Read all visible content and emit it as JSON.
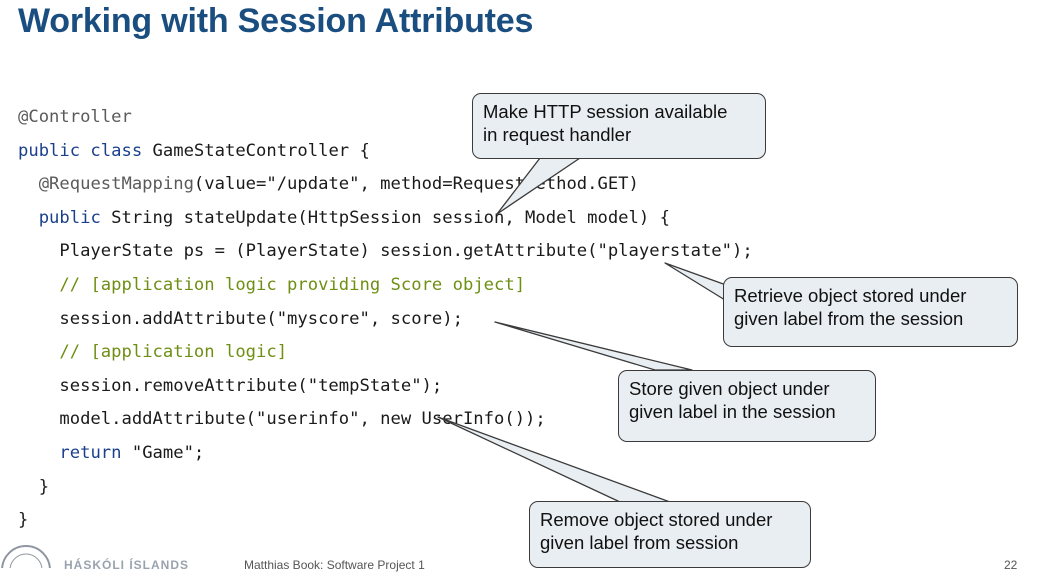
{
  "slide": {
    "title": "Working with Session Attributes"
  },
  "code": {
    "lines": [
      [
        {
          "t": "ann",
          "s": "@Controller"
        }
      ],
      [
        {
          "t": "kw",
          "s": "public class "
        },
        {
          "t": "plain",
          "s": "GameStateController {"
        }
      ],
      [
        {
          "t": "plain",
          "s": "  "
        },
        {
          "t": "ann",
          "s": "@RequestMapping"
        },
        {
          "t": "plain",
          "s": "(value=\"/update\", method=RequestMethod.GET)"
        }
      ],
      [
        {
          "t": "plain",
          "s": "  "
        },
        {
          "t": "kw",
          "s": "public "
        },
        {
          "t": "plain",
          "s": "String stateUpdate(HttpSession session, Model model) {"
        }
      ],
      [
        {
          "t": "plain",
          "s": "    PlayerState ps = (PlayerState) session.getAttribute(\"playerstate\");"
        }
      ],
      [
        {
          "t": "plain",
          "s": "    "
        },
        {
          "t": "cmt",
          "s": "// [application logic providing Score object]"
        }
      ],
      [
        {
          "t": "plain",
          "s": "    session.addAttribute(\"myscore\", score);"
        }
      ],
      [
        {
          "t": "plain",
          "s": "    "
        },
        {
          "t": "cmt",
          "s": "// [application logic]"
        }
      ],
      [
        {
          "t": "plain",
          "s": "    session.removeAttribute(\"tempState\");"
        }
      ],
      [
        {
          "t": "plain",
          "s": "    model.addAttribute(\"userinfo\", new UserInfo());"
        }
      ],
      [
        {
          "t": "plain",
          "s": "    "
        },
        {
          "t": "kw",
          "s": "return "
        },
        {
          "t": "plain",
          "s": "\"Game\";"
        }
      ],
      [
        {
          "t": "plain",
          "s": "  }"
        }
      ],
      [
        {
          "t": "plain",
          "s": "}"
        }
      ]
    ]
  },
  "callouts": {
    "session_available": "Make HTTP session available\nin request handler",
    "retrieve": "Retrieve object stored under\ngiven label from the session",
    "store": "Store given object under\ngiven label in the session",
    "remove": "Remove object stored under\ngiven label from session"
  },
  "footer": {
    "university": "HÁSKÓLI ÍSLANDS",
    "author": "Matthias Book: Software Project 1",
    "page": "22"
  },
  "colors": {
    "title": "#1b4e80",
    "keyword": "#1a3f8c",
    "comment": "#6e8f13",
    "callout_fill": "#e9eef2"
  }
}
